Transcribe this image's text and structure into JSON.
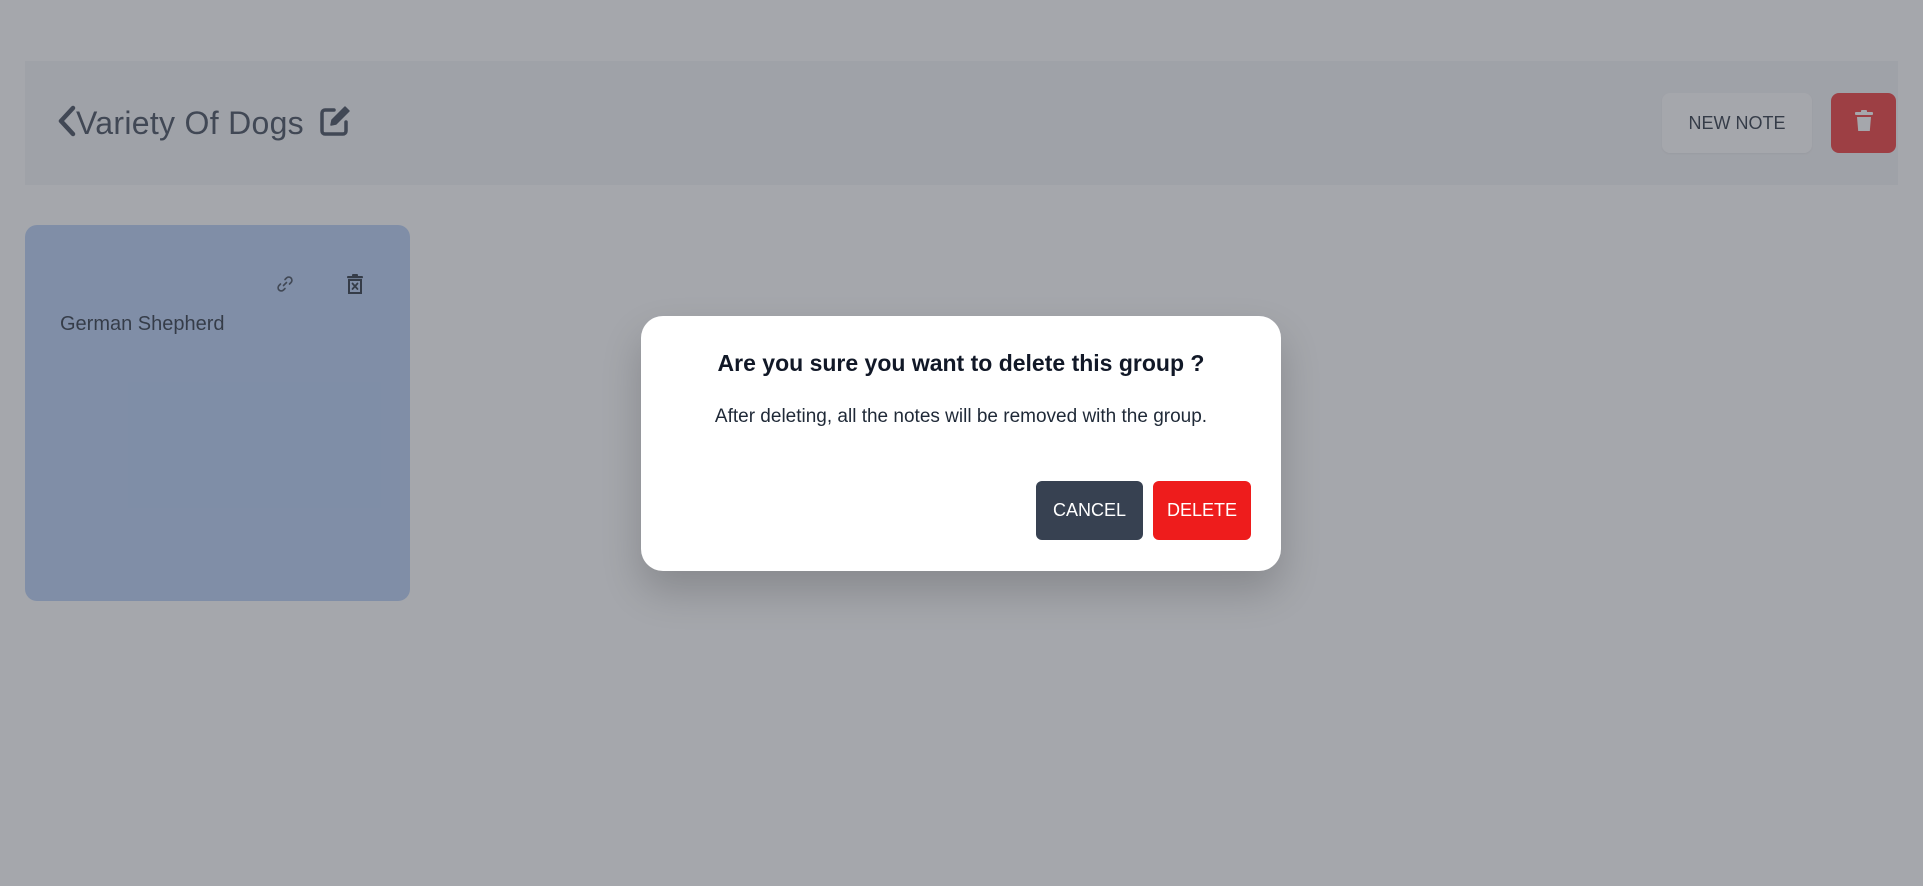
{
  "header": {
    "back_icon": "chevron-left-icon",
    "title": "Variety Of Dogs",
    "edit_icon": "edit-icon",
    "new_note_label": "NEW NOTE",
    "delete_icon": "trash-icon"
  },
  "notes": [
    {
      "title": "German Shepherd",
      "link_icon": "link-icon",
      "delete_icon": "trash-x-icon",
      "color": "#b4cdf5"
    }
  ],
  "modal": {
    "title": "Are you sure you want to delete this group ?",
    "message": "After deleting, all the notes will be removed with the group.",
    "cancel_label": "CANCEL",
    "delete_label": "DELETE"
  },
  "colors": {
    "overlay": "#4b4f5a",
    "danger": "#ee1c1c",
    "dark_button": "#374151",
    "header_bg": "#f3f4f6",
    "note_bg": "#b4cdf5"
  }
}
